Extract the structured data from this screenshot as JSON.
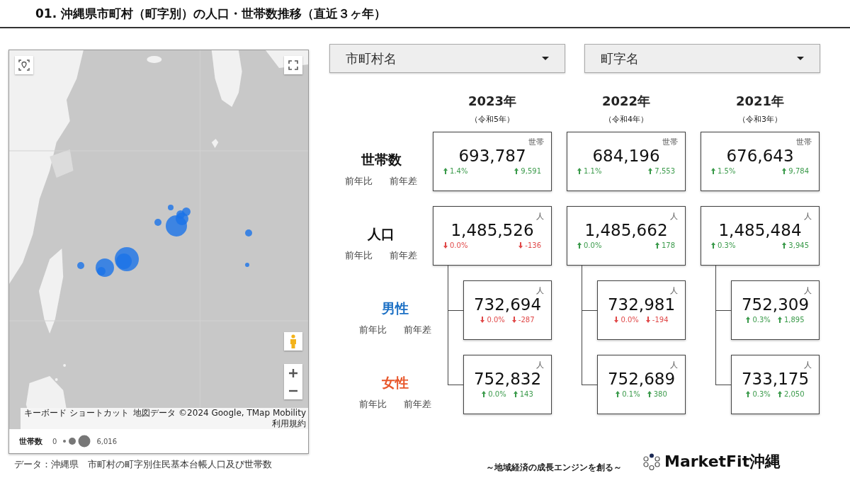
{
  "title": "01. 沖縄県市町村（町字別）の人口・世帯数推移（直近３ヶ年）",
  "map": {
    "attribution": [
      "キーボード ショートカット",
      "地図データ ©2024 Google, TMap Mobility",
      "利用規約"
    ],
    "legend": {
      "label": "世帯数",
      "min": "0",
      "max": "6,016"
    }
  },
  "source": "データ：沖縄県　市町村の町字別住民基本台帳人口及び世帯数",
  "filters": [
    {
      "label": "市町村名"
    },
    {
      "label": "町字名"
    }
  ],
  "years": [
    {
      "year": "2023年",
      "era": "（令和5年）"
    },
    {
      "year": "2022年",
      "era": "（令和4年）"
    },
    {
      "year": "2021年",
      "era": "（令和3年）"
    }
  ],
  "metrics": [
    {
      "name": "世帯数",
      "kind": "main",
      "color": "#111111",
      "sub_labels": [
        "前年比",
        "前年差"
      ],
      "cards": [
        {
          "unit": "世帯",
          "value": "693,787",
          "ratio": {
            "text": "1.4%",
            "rising": true
          },
          "diff": {
            "text": "9,591",
            "rising": true
          }
        },
        {
          "unit": "世帯",
          "value": "684,196",
          "ratio": {
            "text": "1.1%",
            "rising": true
          },
          "diff": {
            "text": "7,553",
            "rising": true
          }
        },
        {
          "unit": "世帯",
          "value": "676,643",
          "ratio": {
            "text": "1.5%",
            "rising": true
          },
          "diff": {
            "text": "9,784",
            "rising": true
          }
        }
      ]
    },
    {
      "name": "人口",
      "kind": "main",
      "color": "#111111",
      "sub_labels": [
        "前年比",
        "前年差"
      ],
      "cards": [
        {
          "unit": "人",
          "value": "1,485,526",
          "ratio": {
            "text": "0.0%",
            "rising": false
          },
          "diff": {
            "text": "-136",
            "rising": false
          }
        },
        {
          "unit": "人",
          "value": "1,485,662",
          "ratio": {
            "text": "0.0%",
            "rising": true
          },
          "diff": {
            "text": "178",
            "rising": true
          }
        },
        {
          "unit": "人",
          "value": "1,485,484",
          "ratio": {
            "text": "0.3%",
            "rising": true
          },
          "diff": {
            "text": "3,945",
            "rising": true
          }
        }
      ]
    },
    {
      "name": "男性",
      "kind": "sub",
      "color": "#1a6fc4",
      "sub_labels": [
        "前年比",
        "前年差"
      ],
      "cards": [
        {
          "unit": "人",
          "value": "732,694",
          "ratio": {
            "text": "0.0%",
            "rising": false
          },
          "diff": {
            "text": "-287",
            "rising": false
          }
        },
        {
          "unit": "人",
          "value": "732,981",
          "ratio": {
            "text": "0.0%",
            "rising": false
          },
          "diff": {
            "text": "-194",
            "rising": false
          }
        },
        {
          "unit": "人",
          "value": "752,309",
          "ratio": {
            "text": "0.3%",
            "rising": true
          },
          "diff": {
            "text": "1,895",
            "rising": true
          }
        }
      ]
    },
    {
      "name": "女性",
      "kind": "sub",
      "color": "#e8562a",
      "sub_labels": [
        "前年比",
        "前年差"
      ],
      "cards": [
        {
          "unit": "人",
          "value": "752,832",
          "ratio": {
            "text": "0.0%",
            "rising": true
          },
          "diff": {
            "text": "143",
            "rising": true
          }
        },
        {
          "unit": "人",
          "value": "752,689",
          "ratio": {
            "text": "0.1%",
            "rising": true
          },
          "diff": {
            "text": "380",
            "rising": true
          }
        },
        {
          "unit": "人",
          "value": "733,175",
          "ratio": {
            "text": "0.3%",
            "rising": true
          },
          "diff": {
            "text": "2,050",
            "rising": true
          }
        }
      ]
    }
  ],
  "tagline": "～地域経済の成長エンジンを創る～",
  "brand": "MarketFit沖縄"
}
